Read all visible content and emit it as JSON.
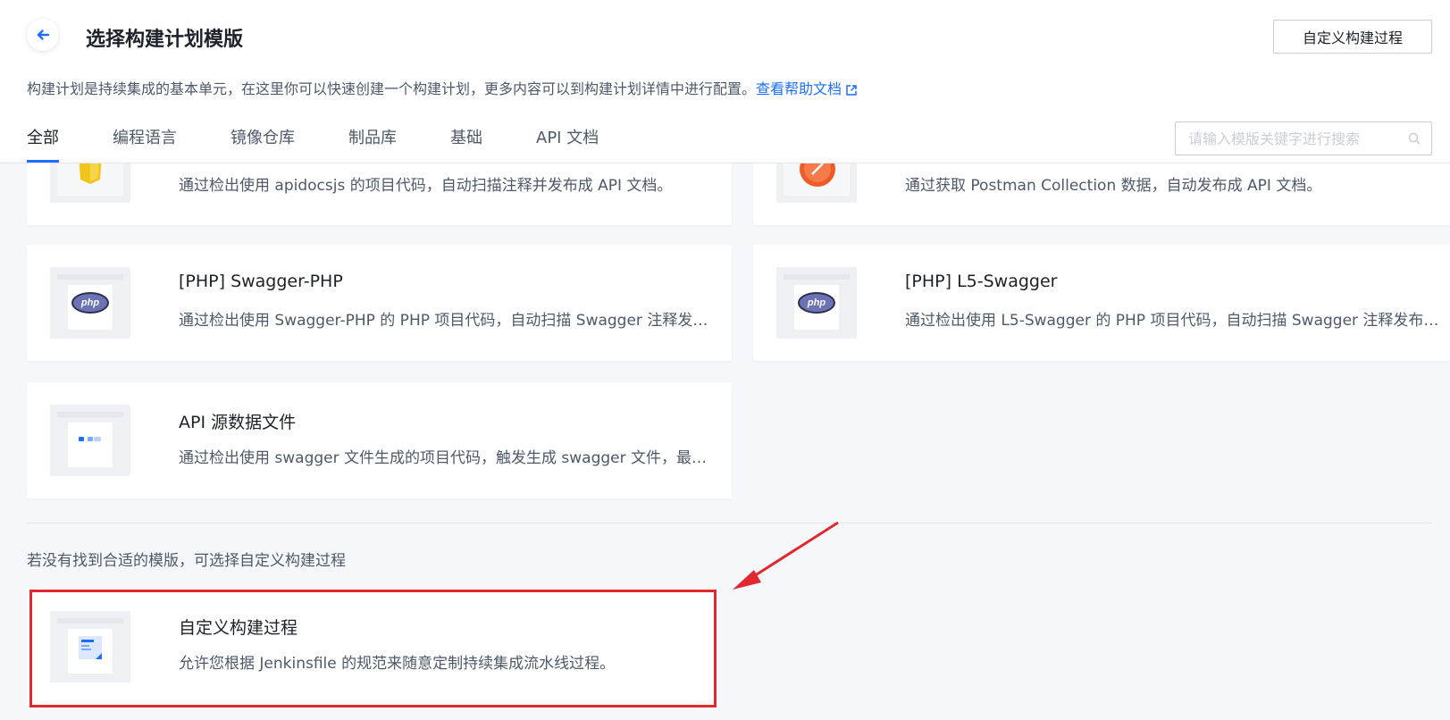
{
  "header": {
    "title": "选择构建计划模版",
    "custom_button": "自定义构建过程",
    "subtitle": "构建计划是持续集成的基本单元，在这里你可以快速创建一个构建计划，更多内容可以到构建计划详情中进行配置。",
    "help_link": "查看帮助文档",
    "search_placeholder": "请输入模版关键字进行搜索"
  },
  "tabs": [
    {
      "label": "全部",
      "active": true
    },
    {
      "label": "编程语言",
      "active": false
    },
    {
      "label": "镜像仓库",
      "active": false
    },
    {
      "label": "制品库",
      "active": false
    },
    {
      "label": "基础",
      "active": false
    },
    {
      "label": "API 文档",
      "active": false
    }
  ],
  "templates": [
    {
      "title": "",
      "desc": "通过检出使用 apidocsjs 的项目代码，自动扫描注释并发布成 API 文档。",
      "icon": "javascript-icon"
    },
    {
      "title": "",
      "desc": "通过获取 Postman Collection 数据，自动发布成 API 文档。",
      "icon": "postman-icon"
    },
    {
      "title": "[PHP] Swagger-PHP",
      "desc": "通过检出使用 Swagger-PHP 的 PHP 项目代码，自动扫描 Swagger 注释发布...",
      "icon": "php-icon",
      "badge": "php"
    },
    {
      "title": "[PHP] L5-Swagger",
      "desc": "通过检出使用 L5-Swagger 的 PHP 项目代码，自动扫描 Swagger 注释发布成...",
      "icon": "php-icon",
      "badge": "php"
    },
    {
      "title": "API 源数据文件",
      "desc": "通过检出使用 swagger 文件生成的项目代码，触发生成 swagger 文件，最终...",
      "icon": "api-source-icon"
    }
  ],
  "hint": "若没有找到合适的模版，可选择自定义构建过程",
  "custom_template": {
    "title": "自定义构建过程",
    "desc": "允许您根据 Jenkinsfile 的规范来随意定制持续集成流水线过程。",
    "icon": "custom-build-icon"
  },
  "colors": {
    "accent": "#1e6fff",
    "highlight": "#e0282e",
    "background": "#f5f7fa"
  }
}
